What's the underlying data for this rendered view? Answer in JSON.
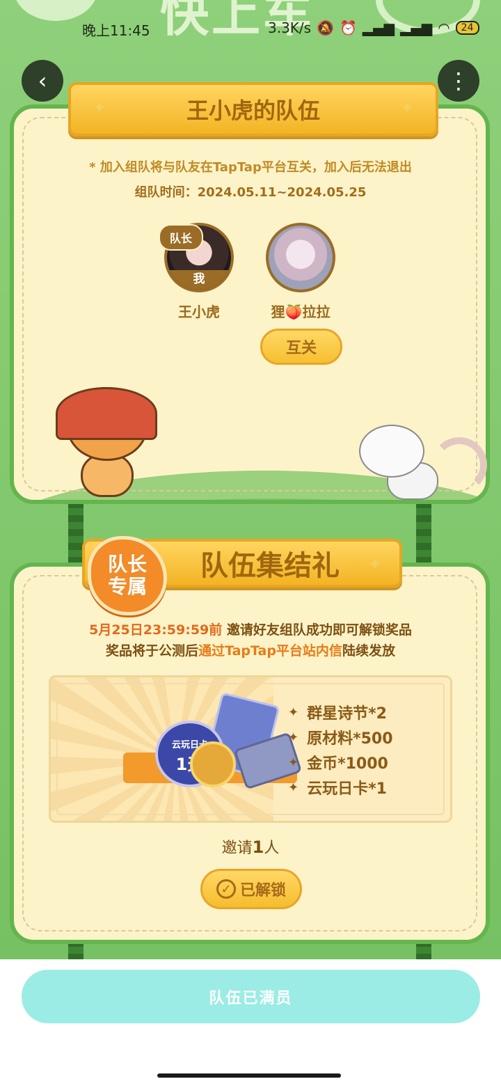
{
  "status_bar": {
    "time": "晚上11:45",
    "speed": "3.3K/s",
    "battery": "24"
  },
  "hero": {
    "text": "快上车"
  },
  "nav": {
    "back_glyph": "‹",
    "more_glyph": "⋮"
  },
  "team": {
    "title": "王小虎的队伍",
    "notice": "* 加入组队将与队友在TapTap平台互关，加入后无法退出",
    "period": "组队时间：2024.05.11~2024.05.25",
    "leader_tag": "队长",
    "me_label": "我",
    "members": [
      {
        "name": "王小虎"
      },
      {
        "name": "狸🍑拉拉"
      }
    ],
    "follow_button": "互关"
  },
  "gift": {
    "badge_line1": "队长",
    "badge_line2": "专属",
    "title": "队伍集结礼",
    "deadline": "5月25日23:59:59前",
    "desc1_rest": " 邀请好友组队成功即可解锁奖品",
    "desc2_pre": "奖品将于公测后",
    "desc2_hl": "通过TapTap平台站内信",
    "desc2_post": "陆续发放",
    "card_top": "云玩日卡",
    "card_num": "1天",
    "rewards": [
      "群星诗节*2",
      "原材料*500",
      "金币*1000",
      "云玩日卡*1"
    ],
    "invite_pre": "邀请",
    "invite_num": "1",
    "invite_post": "人",
    "unlock_button": "已解锁"
  },
  "footer": {
    "full_button": "队伍已满员"
  }
}
